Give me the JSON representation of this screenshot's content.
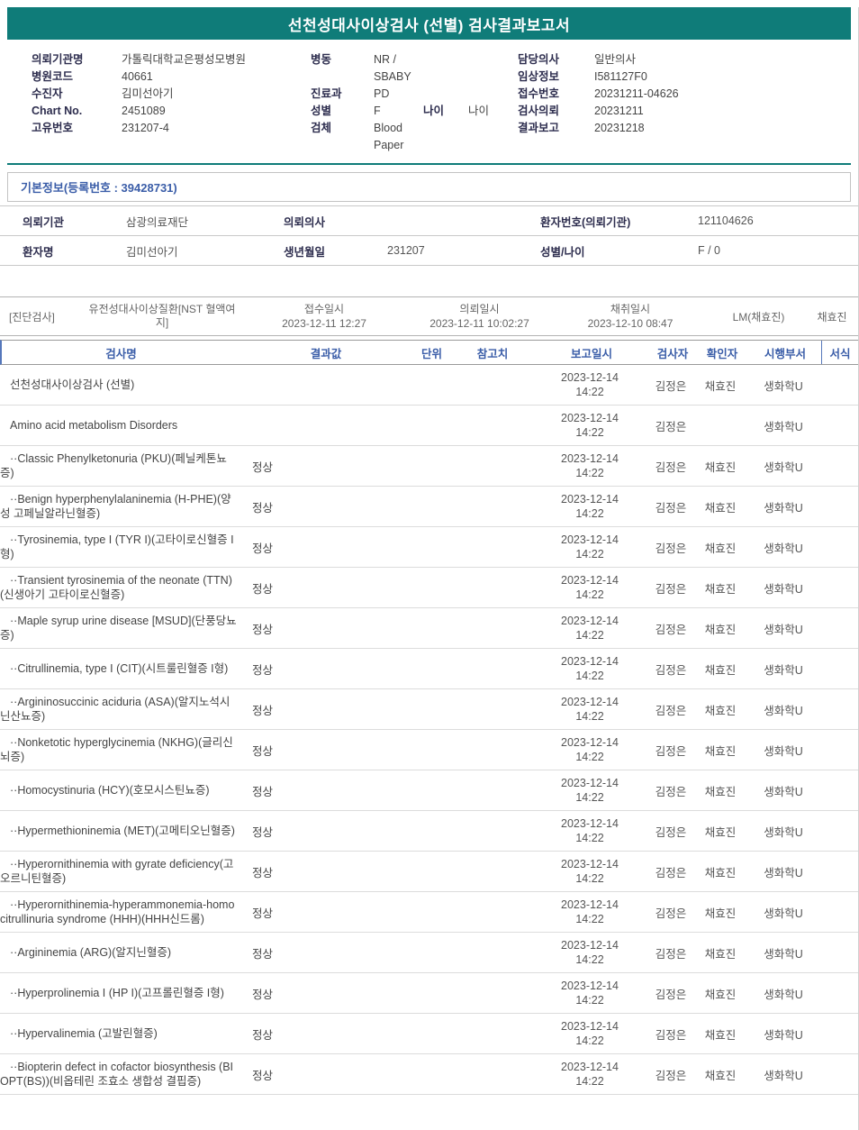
{
  "title": "선천성대사이상검사 (선별) 검사결과보고서",
  "header": {
    "col1": [
      {
        "label": "의뢰기관명",
        "value": "가톨릭대학교은평성모병원"
      },
      {
        "label": "병원코드",
        "value": "40661"
      },
      {
        "label": "수진자",
        "value": "김미선아기"
      },
      {
        "label": "Chart No.",
        "value": "2451089"
      },
      {
        "label": "고유번호",
        "value": "231207-4"
      }
    ],
    "col2": [
      {
        "label": "병동",
        "value": "NR / SBABY"
      },
      {
        "label": "진료과",
        "value": "PD"
      },
      {
        "label": "성별",
        "value": "F",
        "label2": "나이",
        "value2": "나이"
      },
      {
        "label": "검체",
        "value": "Blood Paper"
      }
    ],
    "col3": [
      {
        "label": "담당의사",
        "value": "일반의사"
      },
      {
        "label": "임상정보",
        "value": "I581127F0"
      },
      {
        "label": "접수번호",
        "value": "20231211-04626"
      },
      {
        "label": "검사의뢰",
        "value": "20231211"
      },
      {
        "label": "결과보고",
        "value": "20231218"
      }
    ]
  },
  "basic_info": {
    "title": "기본정보(등록번호 : 39428731)"
  },
  "patient": {
    "rows": [
      [
        {
          "label": "의뢰기관",
          "value": "삼광의료재단"
        },
        {
          "label": "의뢰의사",
          "value": ""
        },
        {
          "label": "환자번호(의뢰기관)",
          "value": "121104626"
        }
      ],
      [
        {
          "label": "환자명",
          "value": "김미선아기"
        },
        {
          "label": "생년월일",
          "value": "231207"
        },
        {
          "label": "성별/나이",
          "value": "F / 0"
        }
      ]
    ]
  },
  "order": {
    "tag": "[진단검사]",
    "test": "유전성대사이상질환[NST 혈액여지]",
    "received_label": "접수일시",
    "received": "2023-12-11 12:27",
    "requested_label": "의뢰일시",
    "requested": "2023-12-11 10:02:27",
    "collected_label": "채취일시",
    "collected": "2023-12-10 08:47",
    "collector": "LM(채효진)",
    "nurse": "채효진"
  },
  "results": {
    "columns": [
      "검사명",
      "결과값",
      "단위",
      "참고치",
      "보고일시",
      "검사자",
      "확인자",
      "시행부서",
      "서식"
    ],
    "rows": [
      {
        "name": "선천성대사이상검사 (선별)",
        "result": "",
        "unit": "",
        "ref": "",
        "reported": "2023-12-14 14:22",
        "tester": "김정은",
        "verifier": "채효진",
        "dept": "생화학U",
        "format": ""
      },
      {
        "name": "Amino acid metabolism Disorders",
        "result": "",
        "unit": "",
        "ref": "",
        "reported": "2023-12-14 14:22",
        "tester": "김정은",
        "verifier": "",
        "dept": "생화학U",
        "format": ""
      },
      {
        "name": "··Classic Phenylketonuria (PKU)(페닐케톤뇨증)",
        "result": "정상",
        "unit": "",
        "ref": "",
        "reported": "2023-12-14 14:22",
        "tester": "김정은",
        "verifier": "채효진",
        "dept": "생화학U",
        "format": ""
      },
      {
        "name": "··Benign hyperphenylalaninemia (H-PHE)(양성 고페닐알라닌혈증)",
        "result": "정상",
        "unit": "",
        "ref": "",
        "reported": "2023-12-14 14:22",
        "tester": "김정은",
        "verifier": "채효진",
        "dept": "생화학U",
        "format": ""
      },
      {
        "name": "··Tyrosinemia, type I (TYR I)(고타이로신혈증 I형)",
        "result": "정상",
        "unit": "",
        "ref": "",
        "reported": "2023-12-14 14:22",
        "tester": "김정은",
        "verifier": "채효진",
        "dept": "생화학U",
        "format": ""
      },
      {
        "name": "··Transient tyrosinemia of the neonate (TTN)(신생아기 고타이로신혈증)",
        "result": "정상",
        "unit": "",
        "ref": "",
        "reported": "2023-12-14 14:22",
        "tester": "김정은",
        "verifier": "채효진",
        "dept": "생화학U",
        "format": ""
      },
      {
        "name": "··Maple syrup urine disease [MSUD](단풍당뇨증)",
        "result": "정상",
        "unit": "",
        "ref": "",
        "reported": "2023-12-14 14:22",
        "tester": "김정은",
        "verifier": "채효진",
        "dept": "생화학U",
        "format": ""
      },
      {
        "name": "··Citrullinemia, type I (CIT)(시트룰린혈증 I형)",
        "result": "정상",
        "unit": "",
        "ref": "",
        "reported": "2023-12-14 14:22",
        "tester": "김정은",
        "verifier": "채효진",
        "dept": "생화학U",
        "format": ""
      },
      {
        "name": "··Argininosuccinic aciduria (ASA)(알지노석시닌산뇨증)",
        "result": "정상",
        "unit": "",
        "ref": "",
        "reported": "2023-12-14 14:22",
        "tester": "김정은",
        "verifier": "채효진",
        "dept": "생화학U",
        "format": ""
      },
      {
        "name": "··Nonketotic hyperglycinemia (NKHG)(글리신뇌증)",
        "result": "정상",
        "unit": "",
        "ref": "",
        "reported": "2023-12-14 14:22",
        "tester": "김정은",
        "verifier": "채효진",
        "dept": "생화학U",
        "format": ""
      },
      {
        "name": "··Homocystinuria (HCY)(호모시스틴뇨증)",
        "result": "정상",
        "unit": "",
        "ref": "",
        "reported": "2023-12-14 14:22",
        "tester": "김정은",
        "verifier": "채효진",
        "dept": "생화학U",
        "format": ""
      },
      {
        "name": "··Hypermethioninemia (MET)(고메티오닌혈증)",
        "result": "정상",
        "unit": "",
        "ref": "",
        "reported": "2023-12-14 14:22",
        "tester": "김정은",
        "verifier": "채효진",
        "dept": "생화학U",
        "format": ""
      },
      {
        "name": "··Hyperornithinemia with gyrate deficiency(고오르니틴혈증)",
        "result": "정상",
        "unit": "",
        "ref": "",
        "reported": "2023-12-14 14:22",
        "tester": "김정은",
        "verifier": "채효진",
        "dept": "생화학U",
        "format": ""
      },
      {
        "name": "··Hyperornithinemia-hyperammonemia-homocitrullinuria syndrome (HHH)(HHH신드롬)",
        "result": "정상",
        "unit": "",
        "ref": "",
        "reported": "2023-12-14 14:22",
        "tester": "김정은",
        "verifier": "채효진",
        "dept": "생화학U",
        "format": ""
      },
      {
        "name": "··Argininemia (ARG)(알지닌혈증)",
        "result": "정상",
        "unit": "",
        "ref": "",
        "reported": "2023-12-14 14:22",
        "tester": "김정은",
        "verifier": "채효진",
        "dept": "생화학U",
        "format": ""
      },
      {
        "name": "··Hyperprolinemia I (HP I)(고프롤린혈증 I형)",
        "result": "정상",
        "unit": "",
        "ref": "",
        "reported": "2023-12-14 14:22",
        "tester": "김정은",
        "verifier": "채효진",
        "dept": "생화학U",
        "format": ""
      },
      {
        "name": "··Hypervalinemia (고발린혈증)",
        "result": "정상",
        "unit": "",
        "ref": "",
        "reported": "2023-12-14 14:22",
        "tester": "김정은",
        "verifier": "채효진",
        "dept": "생화학U",
        "format": ""
      },
      {
        "name": "··Biopterin defect in cofactor biosynthesis (BIOPT(BS))(비옵테린 조효소 생합성 결핍증)",
        "result": "정상",
        "unit": "",
        "ref": "",
        "reported": "2023-12-14 14:22",
        "tester": "김정은",
        "verifier": "채효진",
        "dept": "생화학U",
        "format": ""
      }
    ]
  }
}
